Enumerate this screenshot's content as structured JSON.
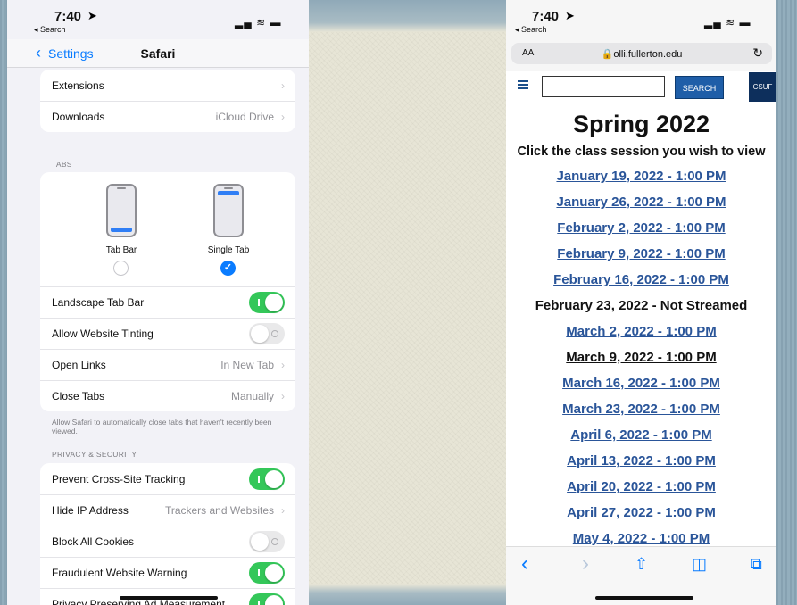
{
  "left": {
    "status": {
      "time": "7:40",
      "back": "◂ Search",
      "icons": "▂▄ ≋ ▬"
    },
    "nav": {
      "back_label": "Settings",
      "title": "Safari"
    },
    "group1": [
      {
        "label": "Extensions",
        "value": ""
      },
      {
        "label": "Downloads",
        "value": "iCloud Drive"
      }
    ],
    "tabs_header": "TABS",
    "tab_options": [
      {
        "label": "Tab Bar",
        "selected": false
      },
      {
        "label": "Single Tab",
        "selected": true
      }
    ],
    "tabs_rows": [
      {
        "label": "Landscape Tab Bar",
        "toggle": "on"
      },
      {
        "label": "Allow Website Tinting",
        "toggle": "off"
      },
      {
        "label": "Open Links",
        "value": "In New Tab"
      },
      {
        "label": "Close Tabs",
        "value": "Manually"
      }
    ],
    "tabs_footnote": "Allow Safari to automatically close tabs that haven't recently been viewed.",
    "privacy_header": "PRIVACY & SECURITY",
    "privacy_rows": [
      {
        "label": "Prevent Cross-Site Tracking",
        "toggle": "on"
      },
      {
        "label": "Hide IP Address",
        "value": "Trackers and Websites"
      },
      {
        "label": "Block All Cookies",
        "toggle": "off"
      },
      {
        "label": "Fraudulent Website Warning",
        "toggle": "on"
      },
      {
        "label": "Privacy Preserving Ad Measurement",
        "toggle": "on"
      }
    ]
  },
  "right": {
    "status": {
      "time": "7:40",
      "back": "◂ Search",
      "icons": "▂▄ ≋ ▬"
    },
    "urlbar": {
      "aa": "AA",
      "url": "🔒olli.fullerton.edu",
      "reload": "↻"
    },
    "site": {
      "search_button": "SEARCH",
      "csuf": "CSUF",
      "menu_icon": "hamburger-menu-icon"
    },
    "page_title": "Spring 2022",
    "page_subtitle": "Click the class session you wish to view",
    "sessions": [
      {
        "label": "January 19, 2022 - 1:00 PM",
        "style": "link"
      },
      {
        "label": "January 26, 2022 - 1:00 PM",
        "style": "link"
      },
      {
        "label": "February 2, 2022 - 1:00 PM",
        "style": "link"
      },
      {
        "label": "February 9, 2022 - 1:00 PM",
        "style": "link"
      },
      {
        "label": "February 16, 2022 - 1:00 PM",
        "style": "link"
      },
      {
        "label": "February 23, 2022 - Not Streamed",
        "style": "plain"
      },
      {
        "label": "March 2, 2022 - 1:00 PM",
        "style": "link"
      },
      {
        "label": "March 9, 2022 - 1:00 PM",
        "style": "plain"
      },
      {
        "label": "March 16, 2022 - 1:00 PM",
        "style": "link"
      },
      {
        "label": "March 23, 2022 - 1:00 PM",
        "style": "link"
      },
      {
        "label": "April 6, 2022 - 1:00 PM",
        "style": "link"
      },
      {
        "label": "April 13, 2022 - 1:00 PM",
        "style": "link"
      },
      {
        "label": "April 20, 2022 - 1:00 PM",
        "style": "link"
      },
      {
        "label": "April 27, 2022 - 1:00 PM",
        "style": "link"
      },
      {
        "label": "May 4, 2022 - 1:00 PM",
        "style": "link"
      }
    ],
    "toolbar": [
      {
        "icon": "back-icon",
        "glyph": "‹",
        "enabled": true
      },
      {
        "icon": "forward-icon",
        "glyph": "›",
        "enabled": false
      },
      {
        "icon": "share-icon",
        "glyph": "⇧",
        "enabled": true
      },
      {
        "icon": "bookmarks-icon",
        "glyph": "◫",
        "enabled": true
      },
      {
        "icon": "tabs-icon",
        "glyph": "⧉",
        "enabled": true
      }
    ]
  }
}
